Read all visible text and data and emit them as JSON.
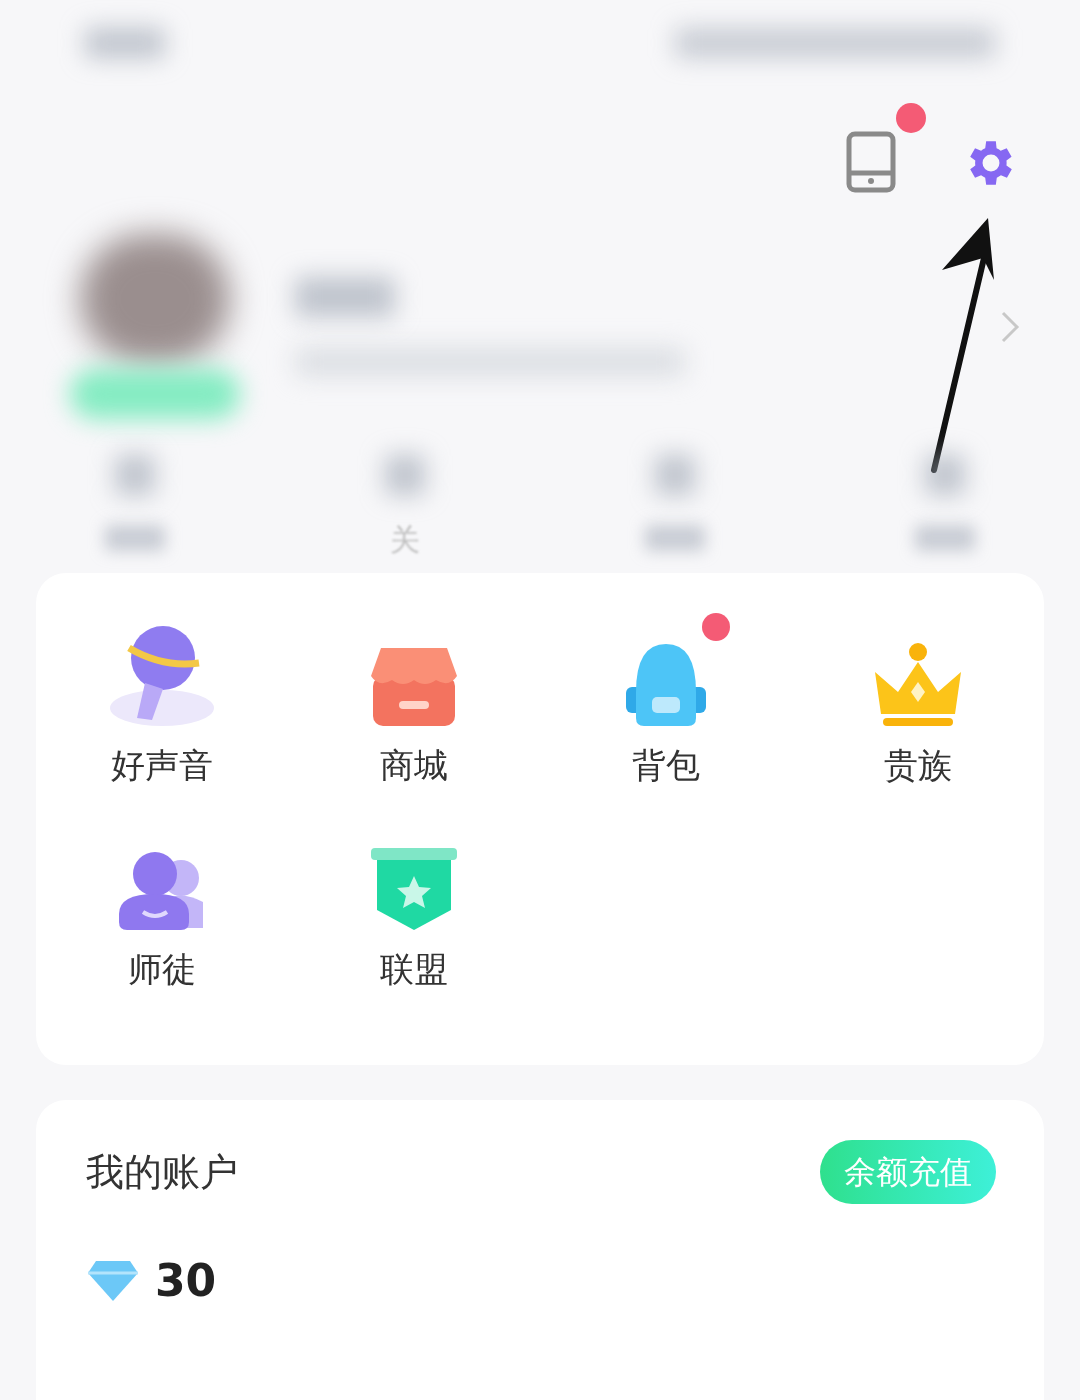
{
  "header": {
    "device_icon": {
      "badge": true
    }
  },
  "stats": [
    {
      "kind": "blurred"
    },
    {
      "kind": "labelled",
      "label": "关"
    },
    {
      "kind": "blurred"
    },
    {
      "kind": "blurred"
    }
  ],
  "features": [
    {
      "kind": "mic",
      "label": "好声音",
      "badge": false
    },
    {
      "kind": "shop",
      "label": "商城",
      "badge": false
    },
    {
      "kind": "backpack",
      "label": "背包",
      "badge": true
    },
    {
      "kind": "crown",
      "label": "贵族",
      "badge": false
    },
    {
      "kind": "mentor",
      "label": "师徒",
      "badge": false
    },
    {
      "kind": "league",
      "label": "联盟",
      "badge": false
    }
  ],
  "account": {
    "title": "我的账户",
    "recharge_button": "余额充值",
    "diamonds": "30"
  }
}
